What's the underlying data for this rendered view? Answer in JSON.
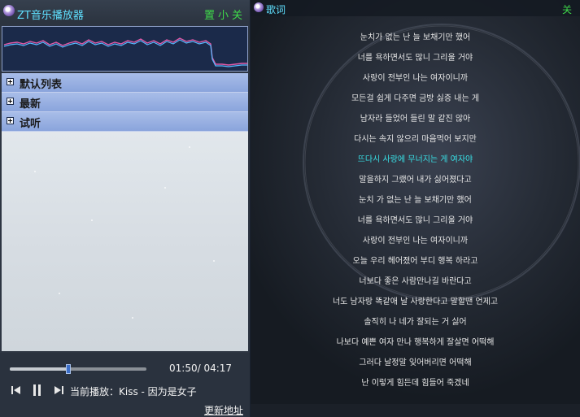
{
  "window": {
    "app_title": "ZT音乐播放器",
    "btn_settings": "置",
    "btn_minimize": "小",
    "btn_close": "关"
  },
  "playlist": {
    "groups": [
      {
        "label": "默认列表"
      },
      {
        "label": "最新"
      },
      {
        "label": "试听"
      }
    ]
  },
  "player": {
    "current_time": "01:50",
    "total_time": "04:17",
    "time_separator": "/",
    "progress": 0.428,
    "now_playing_prefix": "当前播放：",
    "now_playing": "Kiss - 因为是女子",
    "update_link": "更新地址"
  },
  "lyrics_panel": {
    "title": "歌词",
    "close": "关",
    "active_index": 6,
    "lines": [
      "눈치가 없는 난 늘 보채기만 했어",
      "너를 욕하면서도 많니 그리울 거야",
      "사랑이 전부인 나는 여자이니까",
      "모든걸 쉽게 다주면 금방 싫증 내는 게",
      "남자라 들었어 들린 말 같진 않아",
      "다시는 속지 않으리 마음먹어 보지만",
      "뜨다시 사랑에 무너지는 게 여자야",
      "말을하지 그랬어 내가 싫어졌다고",
      "눈치 가 없는 난 늘 보채기만 했어",
      "너를 욕하면서도 많니 그리울 거야",
      "사랑이 전부인 나는 여자이니까",
      "오늘 우리 헤어졌어 부디 행복 하라고",
      "너보다 좋은 사람만나길 바란다고",
      "너도 남자랑 똑같애 날 사랑한다고 말할땐 언제고",
      "솔직히 나 네가 잘되는 거 싫어",
      "나보다 예쁜 여자 만나 행복하게 잘살면 어떡해",
      "그러다 날정말 잊어버리면 어떡해",
      "난 이렇게 힘든데 힘들어 죽겠네"
    ]
  },
  "colors": {
    "accent_cyan": "#5fe0ff",
    "control_green": "#3fd94a",
    "active_lyric": "#38e0e6",
    "spectrum_line": "#58b8ff",
    "spectrum_peak": "#e05aa8"
  }
}
